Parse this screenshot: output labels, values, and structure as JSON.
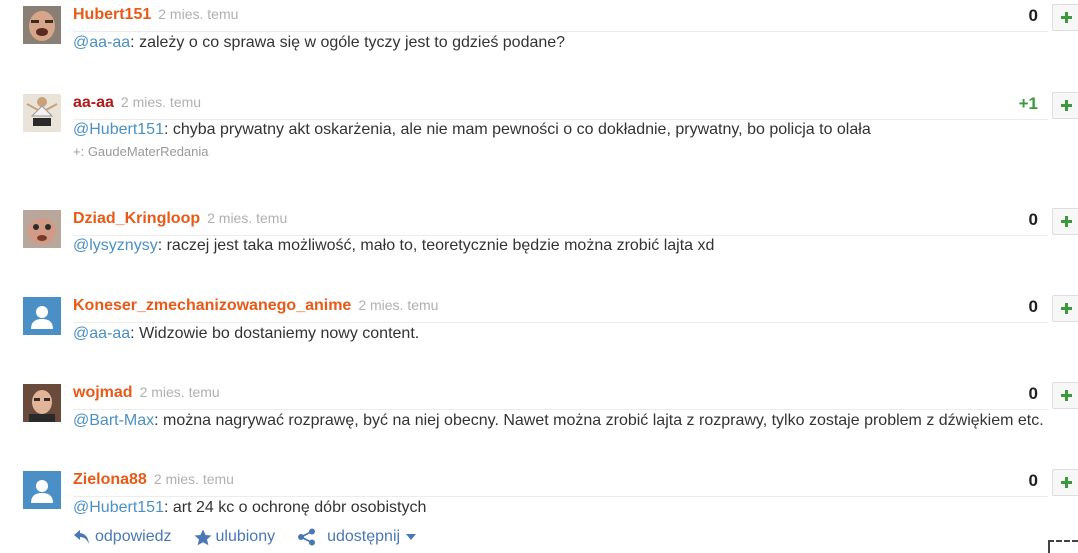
{
  "comments": [
    {
      "author": "Hubert151",
      "author_color": "orange",
      "time": "2 mies. temu",
      "mention": "@aa-aa",
      "text": ": zależy o co sprawa się w ogóle tyczy jest to gdzieś podane?",
      "score": "0",
      "avatar": "photo-face-icon"
    },
    {
      "author": "aa-aa",
      "author_color": "darkred",
      "time": "2 mies. temu",
      "mention": "@Hubert151",
      "text": ": chyba prywatny akt oskarżenia, ale nie mam pewności o co dokładnie, prywatny, bo policja to olała",
      "plusby": "+: GaudeMaterRedania",
      "score": "+1",
      "avatar": "photo-figure-icon"
    },
    {
      "author": "Dziad_Kringloop",
      "author_color": "orange",
      "time": "2 mies. temu",
      "mention": "@lysyznysy",
      "text": ": raczej jest taka możliwość, mało to, teoretycznie będzie można zrobić lajta xd",
      "score": "0",
      "avatar": "photo-puppet-icon"
    },
    {
      "author": "Koneser_zmechanizowanego_anime",
      "author_color": "orange",
      "time": "2 mies. temu",
      "mention": "@aa-aa",
      "text": ": Widzowie bo dostaniemy nowy content.",
      "score": "0",
      "avatar": "default-user-icon"
    },
    {
      "author": "wojmad",
      "author_color": "orange",
      "time": "2 mies. temu",
      "mention": "@Bart-Max",
      "text": ": można nagrywać rozprawę, być na niej obecny. Nawet można zrobić lajta z rozprawy, tylko zostaje problem z dźwiękiem etc.",
      "score": "0",
      "avatar": "photo-man-icon"
    },
    {
      "author": "Zielona88",
      "author_color": "orange",
      "time": "2 mies. temu",
      "mention": "@Hubert151",
      "text": ": art 24 kc o ochronę dóbr osobistych",
      "score": "0",
      "avatar": "default-user-icon"
    }
  ],
  "actions": {
    "reply": "odpowiedz",
    "favorite": "ulubiony",
    "share": "udostępnij"
  },
  "colors": {
    "author": "#e85a17",
    "author_op": "#b01b1b",
    "mention": "#4a90c6",
    "score_positive": "#3c9a3c",
    "link": "#4a78b4"
  }
}
